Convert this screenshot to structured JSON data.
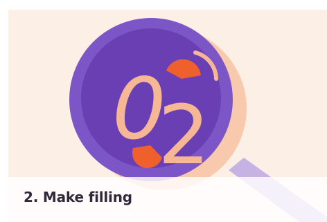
{
  "step": {
    "digit_left": "0",
    "digit_right": "2",
    "title": "2. Make filling"
  },
  "colors": {
    "background": "#fcefe6",
    "lens_outer": "#7c56c6",
    "lens_inner": "#6a3fb3",
    "handle": "#b39ad8",
    "accent_orange": "#f0602d",
    "digit_peach": "#f6b894",
    "caption_text": "#2f2a3a"
  },
  "icons": [
    "magnifying-glass-icon"
  ]
}
